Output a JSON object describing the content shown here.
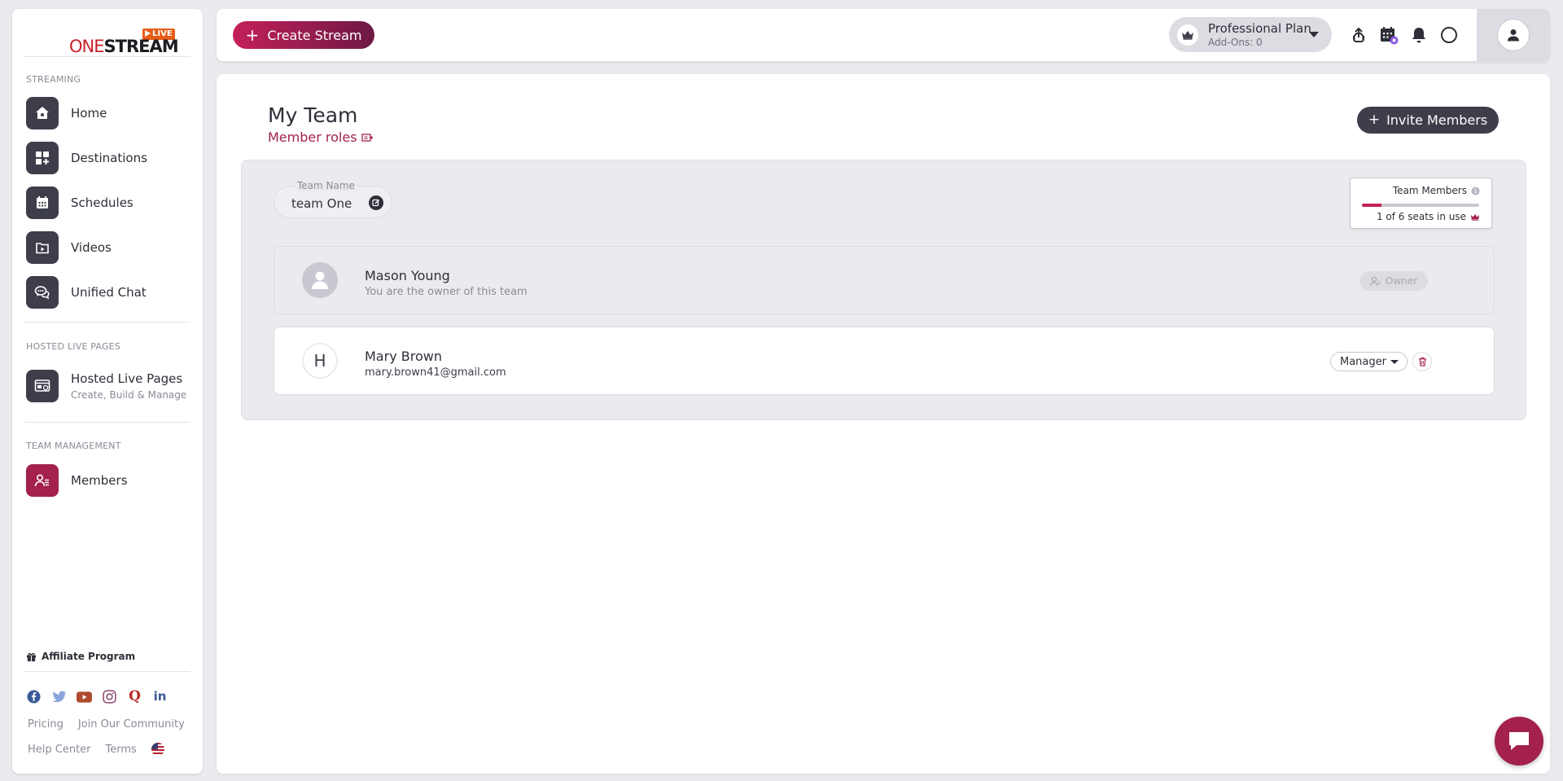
{
  "app": {
    "logo_text_one": "ONE",
    "logo_text_stream": "STREAM",
    "logo_badge": "LIVE",
    "brand_color": "#a3214c"
  },
  "sidebar": {
    "sections": [
      {
        "title": "STREAMING"
      },
      {
        "title": "HOSTED LIVE PAGES"
      },
      {
        "title": "TEAM MANAGEMENT"
      }
    ],
    "items": [
      {
        "label": "Home",
        "icon": "home-icon"
      },
      {
        "label": "Destinations",
        "icon": "grid-plus-icon"
      },
      {
        "label": "Schedules",
        "icon": "calendar-icon"
      },
      {
        "label": "Videos",
        "icon": "video-folder-icon"
      },
      {
        "label": "Unified Chat",
        "icon": "chat-icon"
      },
      {
        "label": "Hosted Live Pages",
        "sub": "Create, Build & Manage",
        "icon": "web-page-icon"
      },
      {
        "label": "Members",
        "icon": "members-icon",
        "active": true
      }
    ],
    "affiliate": "Affiliate Program",
    "socials": [
      "facebook-icon",
      "twitter-icon",
      "youtube-icon",
      "instagram-icon",
      "quora-icon",
      "linkedin-icon"
    ],
    "footer_links": [
      "Pricing",
      "Join Our Community",
      "Help Center",
      "Terms"
    ]
  },
  "topbar": {
    "create_label": "Create Stream",
    "plan_name": "Professional Plan",
    "plan_addons": "Add-Ons: 0"
  },
  "page": {
    "title": "My Team",
    "roles_link": "Member roles",
    "invite_label": "Invite Members",
    "team_name_label": "Team Name",
    "team_name": "team One",
    "seats_title": "Team Members",
    "seats_text": "1 of 6 seats in use",
    "seats_used": 1,
    "seats_total": 6
  },
  "members": [
    {
      "name": "Mason Young",
      "sub": "You are the owner of this team",
      "badge": "Owner",
      "avatar": "user-silhouette"
    },
    {
      "name": "Mary Brown",
      "sub": "mary.brown41@gmail.com",
      "initial": "H",
      "role": "Manager"
    }
  ]
}
